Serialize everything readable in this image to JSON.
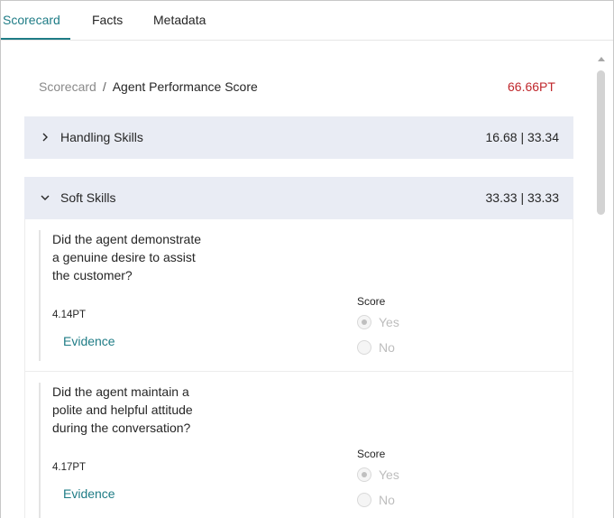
{
  "tabs": [
    {
      "label": "Scorecard",
      "active": true
    },
    {
      "label": "Facts",
      "active": false
    },
    {
      "label": "Metadata",
      "active": false
    }
  ],
  "breadcrumb": {
    "root": "Scorecard",
    "separator": "/",
    "current": "Agent Performance Score"
  },
  "total_score": "66.66PT",
  "sections": [
    {
      "title": "Handling Skills",
      "score": "16.68 | 33.34",
      "expanded": false
    },
    {
      "title": "Soft Skills",
      "score": "33.33 | 33.33",
      "expanded": true
    }
  ],
  "questions": [
    {
      "text": "Did the agent demonstrate a genuine desire to assist the customer?",
      "points": "4.14PT",
      "evidence_label": "Evidence",
      "score_label": "Score",
      "options": [
        "Yes",
        "No"
      ],
      "selected": "Yes"
    },
    {
      "text": "Did the agent maintain a polite and helpful attitude during the conversation?",
      "points": "4.17PT",
      "evidence_label": "Evidence",
      "score_label": "Score",
      "options": [
        "Yes",
        "No"
      ],
      "selected": "Yes"
    }
  ],
  "colors": {
    "accent": "#1f7c86",
    "score_red": "#c0282d",
    "section_header_bg": "#e9ecf4"
  }
}
